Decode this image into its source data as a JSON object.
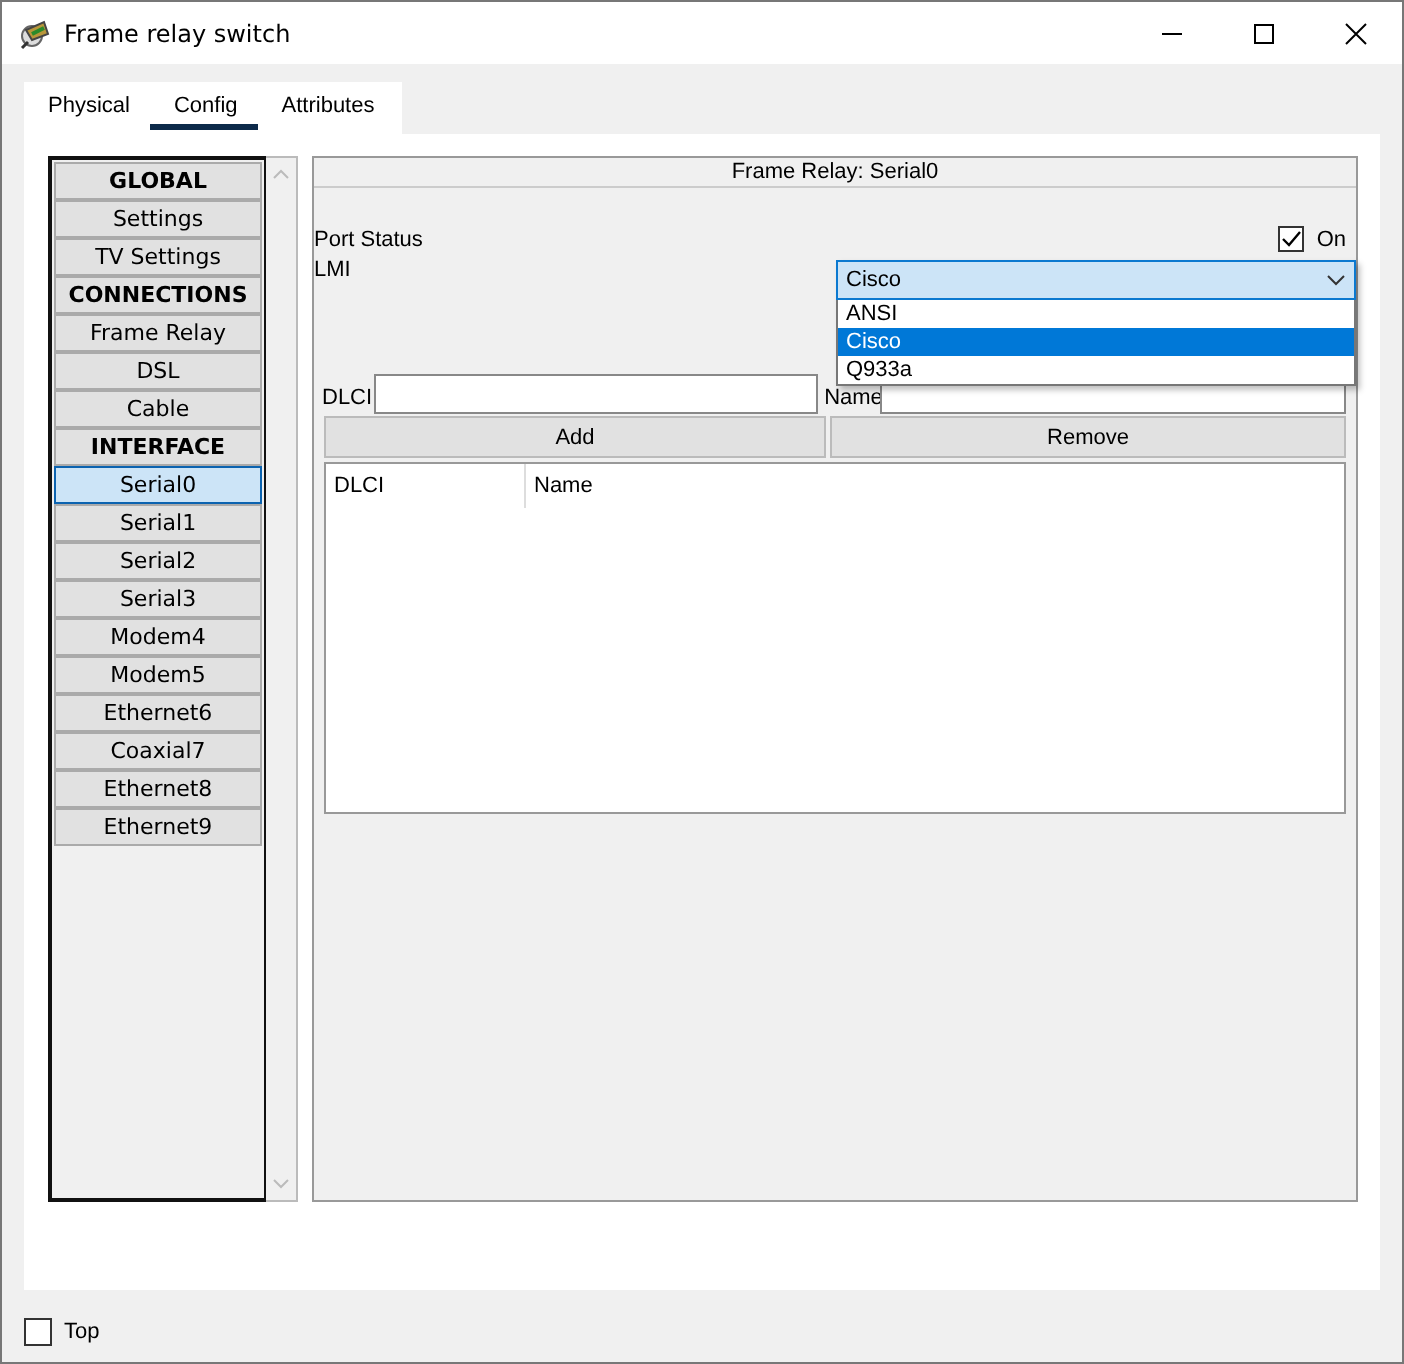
{
  "window": {
    "title": "Frame relay switch"
  },
  "tabs": [
    {
      "label": "Physical",
      "selected": false
    },
    {
      "label": "Config",
      "selected": true
    },
    {
      "label": "Attributes",
      "selected": false
    }
  ],
  "sidebar": {
    "items": [
      {
        "kind": "header",
        "label": "GLOBAL",
        "selected": false
      },
      {
        "kind": "item",
        "label": "Settings",
        "selected": false
      },
      {
        "kind": "item",
        "label": "TV Settings",
        "selected": false
      },
      {
        "kind": "header",
        "label": "CONNECTIONS",
        "selected": false
      },
      {
        "kind": "item",
        "label": "Frame Relay",
        "selected": false
      },
      {
        "kind": "item",
        "label": "DSL",
        "selected": false
      },
      {
        "kind": "item",
        "label": "Cable",
        "selected": false
      },
      {
        "kind": "header",
        "label": "INTERFACE",
        "selected": false
      },
      {
        "kind": "item",
        "label": "Serial0",
        "selected": true
      },
      {
        "kind": "item",
        "label": "Serial1",
        "selected": false
      },
      {
        "kind": "item",
        "label": "Serial2",
        "selected": false
      },
      {
        "kind": "item",
        "label": "Serial3",
        "selected": false
      },
      {
        "kind": "item",
        "label": "Modem4",
        "selected": false
      },
      {
        "kind": "item",
        "label": "Modem5",
        "selected": false
      },
      {
        "kind": "item",
        "label": "Ethernet6",
        "selected": false
      },
      {
        "kind": "item",
        "label": "Coaxial7",
        "selected": false
      },
      {
        "kind": "item",
        "label": "Ethernet8",
        "selected": false
      },
      {
        "kind": "item",
        "label": "Ethernet9",
        "selected": false
      }
    ]
  },
  "panel": {
    "title": "Frame Relay: Serial0",
    "port_status": {
      "label": "Port Status",
      "checkbox_label": "On",
      "checked": true
    },
    "lmi": {
      "label": "LMI",
      "value": "Cisco",
      "options": [
        {
          "label": "ANSI",
          "selected": false
        },
        {
          "label": "Cisco",
          "selected": true
        },
        {
          "label": "Q933a",
          "selected": false
        }
      ]
    },
    "dlci_label": "DLCI",
    "name_label": "Name",
    "buttons": [
      "Add",
      "Remove"
    ],
    "table": {
      "columns": [
        "DLCI",
        "Name"
      ]
    }
  },
  "footer": {
    "checkbox_label": "Top",
    "checked": false
  }
}
